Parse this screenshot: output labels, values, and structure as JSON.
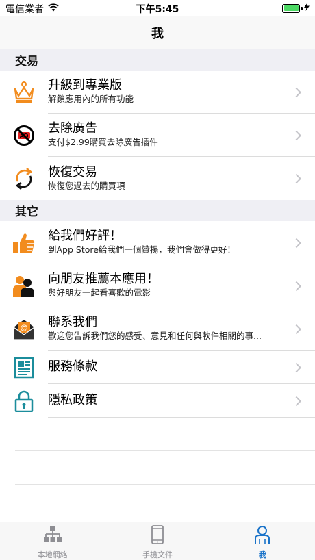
{
  "status_bar": {
    "carrier": "電信業者",
    "time": "下午5:45",
    "battery_color": "#4cd964"
  },
  "nav": {
    "title": "我"
  },
  "sections": {
    "transactions": {
      "header": "交易",
      "items": [
        {
          "title": "升級到專業版",
          "subtitle": "解鎖應用內的所有功能",
          "icon": "crown-icon"
        },
        {
          "title": "去除廣告",
          "subtitle": "支付$2.99購買去除廣告插件",
          "icon": "no-ads-icon"
        },
        {
          "title": "恢復交易",
          "subtitle": "恢復您過去的購買項",
          "icon": "restore-icon"
        }
      ]
    },
    "other": {
      "header": "其它",
      "items": [
        {
          "title": "給我們好評！",
          "subtitle": "到App Store給我們一個贊揚，我們會做得更好！",
          "icon": "thumbs-up-icon"
        },
        {
          "title": "向朋友推薦本應用！",
          "subtitle": "與好朋友一起看喜歡的電影",
          "icon": "friends-icon"
        },
        {
          "title": "聯系我們",
          "subtitle": "歡迎您告訴我們您的感受、意見和任何與軟件相關的事...",
          "icon": "mail-icon"
        },
        {
          "title": "服務條款",
          "icon": "document-icon"
        },
        {
          "title": "隱私政策",
          "icon": "lock-icon"
        }
      ]
    }
  },
  "tab_bar": {
    "tabs": [
      {
        "label": "本地網絡",
        "icon": "network-icon",
        "active": false
      },
      {
        "label": "手機文件",
        "icon": "phone-icon",
        "active": false
      },
      {
        "label": "我",
        "icon": "person-icon",
        "active": true
      }
    ],
    "active_color": "#1a73c9",
    "inactive_color": "#8e8e93"
  },
  "colors": {
    "orange": "#f28c1e",
    "teal": "#1b8d9c"
  }
}
